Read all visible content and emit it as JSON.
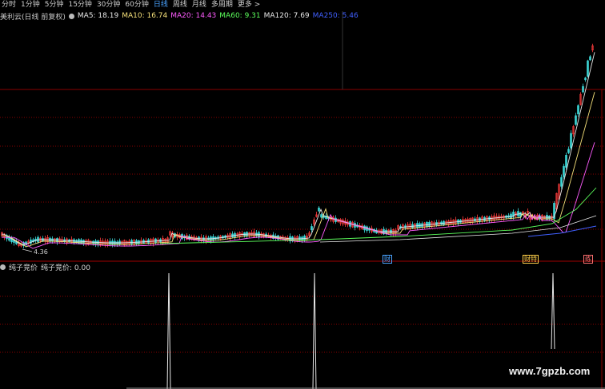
{
  "toolbar": {
    "tabs": [
      "分时",
      "1分钟",
      "5分钟",
      "15分钟",
      "30分钟",
      "60分钟",
      "日线",
      "周线",
      "月线",
      "多周期",
      "更多 >"
    ],
    "active_index": 6
  },
  "legend": {
    "title": "美利云(日线 前复权)",
    "items": [
      {
        "text": "MA5: 18.19",
        "color": "#e8e8e8"
      },
      {
        "text": "MA10: 16.74",
        "color": "#f5e07a"
      },
      {
        "text": "MA20: 14.43",
        "color": "#ff5cff"
      },
      {
        "text": "MA60: 9.31",
        "color": "#5cff5c"
      },
      {
        "text": "MA120: 7.69",
        "color": "#e8e8e8"
      },
      {
        "text": "MA250: 5.46",
        "color": "#4060ff"
      }
    ]
  },
  "price_low_label": "4.36",
  "indicator": {
    "name": "纯子竞价",
    "value_text": "纯子竞价: 0.00"
  },
  "event_marks": [
    {
      "text": "财",
      "color": "#4aa3ff"
    },
    {
      "text": "财特",
      "color": "#ffd04a"
    },
    {
      "text": "练",
      "color": "#ff7070"
    }
  ],
  "watermark": "www.7gpzb.com",
  "colors": {
    "up": "#ff3c3c",
    "down": "#3cd6d6",
    "ma5": "#e8e8e8",
    "ma10": "#f5e07a",
    "ma20": "#ff5cff",
    "ma60": "#5cff5c",
    "ma120": "#e8e8e8",
    "ma250": "#4060ff",
    "grid": "#8a0000"
  }
}
